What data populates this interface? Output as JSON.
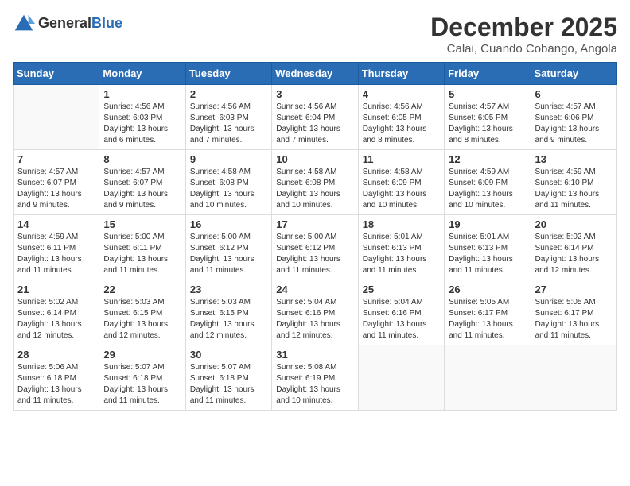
{
  "header": {
    "logo_general": "General",
    "logo_blue": "Blue",
    "month_title": "December 2025",
    "subtitle": "Calai, Cuando Cobango, Angola"
  },
  "days_of_week": [
    "Sunday",
    "Monday",
    "Tuesday",
    "Wednesday",
    "Thursday",
    "Friday",
    "Saturday"
  ],
  "weeks": [
    [
      {
        "day": "",
        "info": ""
      },
      {
        "day": "1",
        "info": "Sunrise: 4:56 AM\nSunset: 6:03 PM\nDaylight: 13 hours\nand 6 minutes."
      },
      {
        "day": "2",
        "info": "Sunrise: 4:56 AM\nSunset: 6:03 PM\nDaylight: 13 hours\nand 7 minutes."
      },
      {
        "day": "3",
        "info": "Sunrise: 4:56 AM\nSunset: 6:04 PM\nDaylight: 13 hours\nand 7 minutes."
      },
      {
        "day": "4",
        "info": "Sunrise: 4:56 AM\nSunset: 6:05 PM\nDaylight: 13 hours\nand 8 minutes."
      },
      {
        "day": "5",
        "info": "Sunrise: 4:57 AM\nSunset: 6:05 PM\nDaylight: 13 hours\nand 8 minutes."
      },
      {
        "day": "6",
        "info": "Sunrise: 4:57 AM\nSunset: 6:06 PM\nDaylight: 13 hours\nand 9 minutes."
      }
    ],
    [
      {
        "day": "7",
        "info": "Sunrise: 4:57 AM\nSunset: 6:07 PM\nDaylight: 13 hours\nand 9 minutes."
      },
      {
        "day": "8",
        "info": "Sunrise: 4:57 AM\nSunset: 6:07 PM\nDaylight: 13 hours\nand 9 minutes."
      },
      {
        "day": "9",
        "info": "Sunrise: 4:58 AM\nSunset: 6:08 PM\nDaylight: 13 hours\nand 10 minutes."
      },
      {
        "day": "10",
        "info": "Sunrise: 4:58 AM\nSunset: 6:08 PM\nDaylight: 13 hours\nand 10 minutes."
      },
      {
        "day": "11",
        "info": "Sunrise: 4:58 AM\nSunset: 6:09 PM\nDaylight: 13 hours\nand 10 minutes."
      },
      {
        "day": "12",
        "info": "Sunrise: 4:59 AM\nSunset: 6:09 PM\nDaylight: 13 hours\nand 10 minutes."
      },
      {
        "day": "13",
        "info": "Sunrise: 4:59 AM\nSunset: 6:10 PM\nDaylight: 13 hours\nand 11 minutes."
      }
    ],
    [
      {
        "day": "14",
        "info": "Sunrise: 4:59 AM\nSunset: 6:11 PM\nDaylight: 13 hours\nand 11 minutes."
      },
      {
        "day": "15",
        "info": "Sunrise: 5:00 AM\nSunset: 6:11 PM\nDaylight: 13 hours\nand 11 minutes."
      },
      {
        "day": "16",
        "info": "Sunrise: 5:00 AM\nSunset: 6:12 PM\nDaylight: 13 hours\nand 11 minutes."
      },
      {
        "day": "17",
        "info": "Sunrise: 5:00 AM\nSunset: 6:12 PM\nDaylight: 13 hours\nand 11 minutes."
      },
      {
        "day": "18",
        "info": "Sunrise: 5:01 AM\nSunset: 6:13 PM\nDaylight: 13 hours\nand 11 minutes."
      },
      {
        "day": "19",
        "info": "Sunrise: 5:01 AM\nSunset: 6:13 PM\nDaylight: 13 hours\nand 11 minutes."
      },
      {
        "day": "20",
        "info": "Sunrise: 5:02 AM\nSunset: 6:14 PM\nDaylight: 13 hours\nand 12 minutes."
      }
    ],
    [
      {
        "day": "21",
        "info": "Sunrise: 5:02 AM\nSunset: 6:14 PM\nDaylight: 13 hours\nand 12 minutes."
      },
      {
        "day": "22",
        "info": "Sunrise: 5:03 AM\nSunset: 6:15 PM\nDaylight: 13 hours\nand 12 minutes."
      },
      {
        "day": "23",
        "info": "Sunrise: 5:03 AM\nSunset: 6:15 PM\nDaylight: 13 hours\nand 12 minutes."
      },
      {
        "day": "24",
        "info": "Sunrise: 5:04 AM\nSunset: 6:16 PM\nDaylight: 13 hours\nand 12 minutes."
      },
      {
        "day": "25",
        "info": "Sunrise: 5:04 AM\nSunset: 6:16 PM\nDaylight: 13 hours\nand 11 minutes."
      },
      {
        "day": "26",
        "info": "Sunrise: 5:05 AM\nSunset: 6:17 PM\nDaylight: 13 hours\nand 11 minutes."
      },
      {
        "day": "27",
        "info": "Sunrise: 5:05 AM\nSunset: 6:17 PM\nDaylight: 13 hours\nand 11 minutes."
      }
    ],
    [
      {
        "day": "28",
        "info": "Sunrise: 5:06 AM\nSunset: 6:18 PM\nDaylight: 13 hours\nand 11 minutes."
      },
      {
        "day": "29",
        "info": "Sunrise: 5:07 AM\nSunset: 6:18 PM\nDaylight: 13 hours\nand 11 minutes."
      },
      {
        "day": "30",
        "info": "Sunrise: 5:07 AM\nSunset: 6:18 PM\nDaylight: 13 hours\nand 11 minutes."
      },
      {
        "day": "31",
        "info": "Sunrise: 5:08 AM\nSunset: 6:19 PM\nDaylight: 13 hours\nand 10 minutes."
      },
      {
        "day": "",
        "info": ""
      },
      {
        "day": "",
        "info": ""
      },
      {
        "day": "",
        "info": ""
      }
    ]
  ]
}
